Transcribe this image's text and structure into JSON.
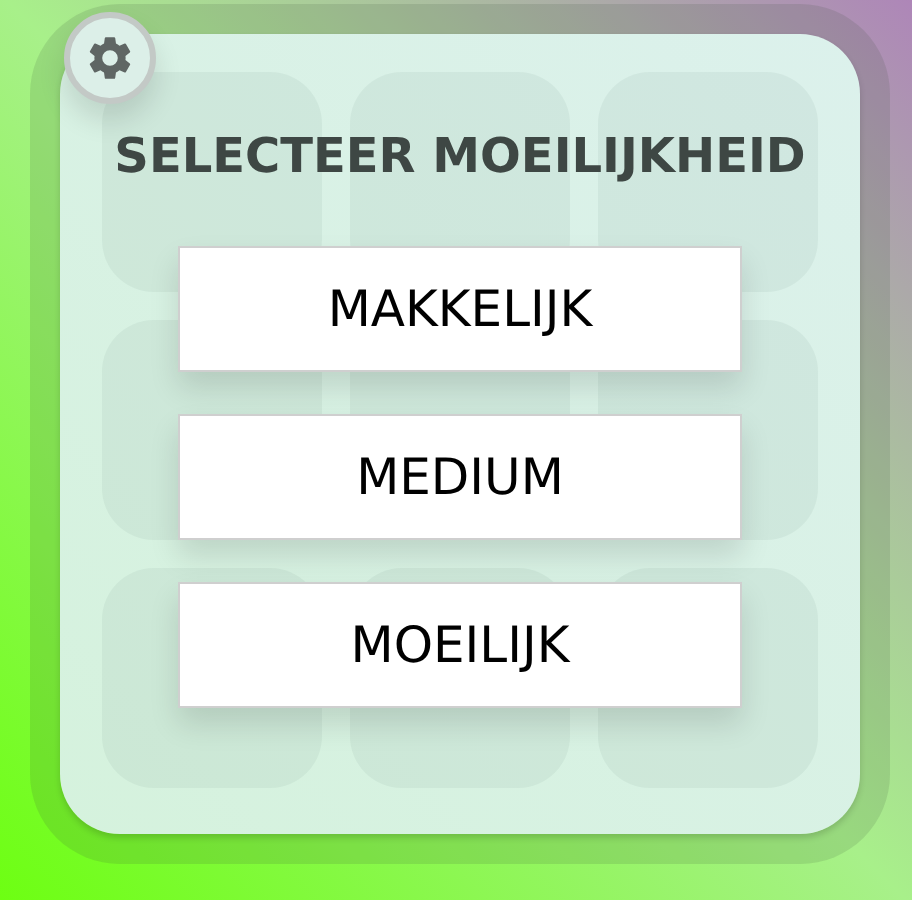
{
  "title": "SELECTEER MOEILIJKHEID",
  "buttons": [
    {
      "label": "MAKKELIJK"
    },
    {
      "label": "MEDIUM"
    },
    {
      "label": "MOEILIJK"
    }
  ]
}
